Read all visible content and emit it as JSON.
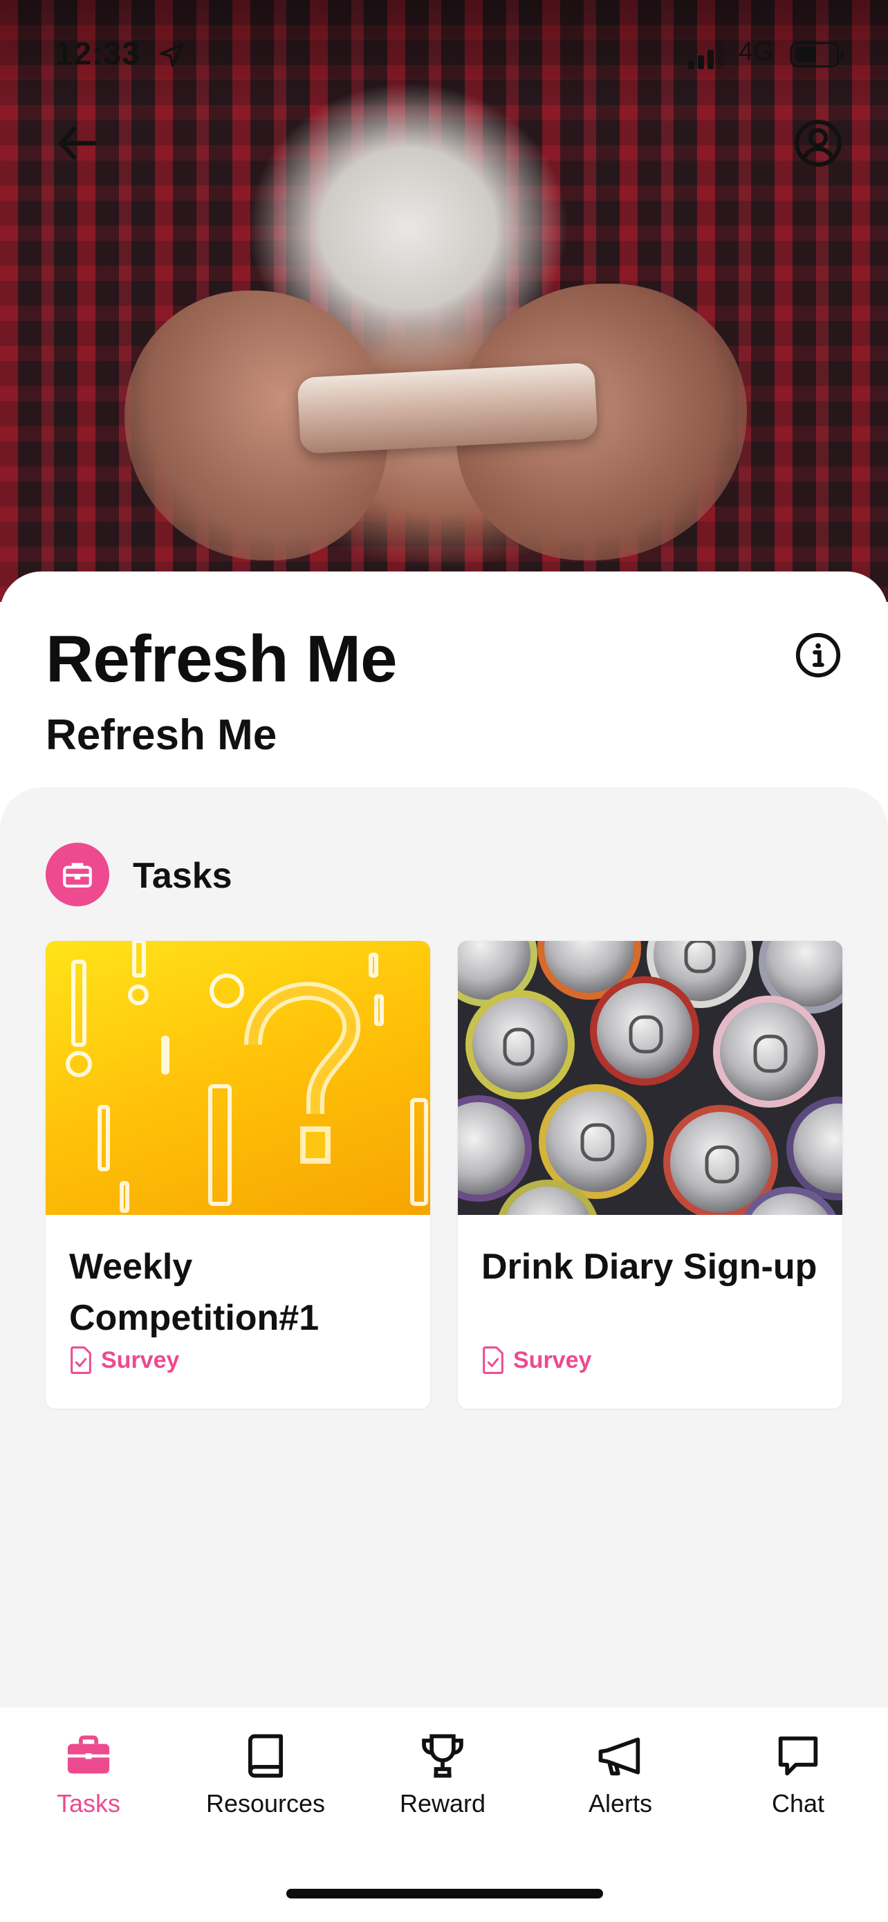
{
  "status_bar": {
    "time": "12:33",
    "network": "4G"
  },
  "header": {
    "back_icon": "arrow-left-icon",
    "profile_icon": "user-circle-icon"
  },
  "page": {
    "title": "Refresh Me",
    "subtitle": "Refresh Me",
    "info_icon": "info-circle-icon"
  },
  "tasks_section": {
    "title": "Tasks",
    "icon": "briefcase-icon",
    "cards": [
      {
        "name": "Weekly Competition#1",
        "type": "Survey",
        "image": "question-marks-yellow"
      },
      {
        "name": "Drink Diary Sign-up",
        "type": "Survey",
        "image": "soda-cans"
      }
    ]
  },
  "bottom_nav": {
    "items": [
      {
        "label": "Tasks",
        "icon": "briefcase-icon",
        "active": true
      },
      {
        "label": "Resources",
        "icon": "book-icon",
        "active": false
      },
      {
        "label": "Reward",
        "icon": "trophy-icon",
        "active": false
      },
      {
        "label": "Alerts",
        "icon": "megaphone-icon",
        "active": false
      },
      {
        "label": "Chat",
        "icon": "chat-bubble-icon",
        "active": false
      }
    ]
  },
  "colors": {
    "accent": "#ed4a8f",
    "background": "#f4f4f5",
    "text": "#111111"
  }
}
